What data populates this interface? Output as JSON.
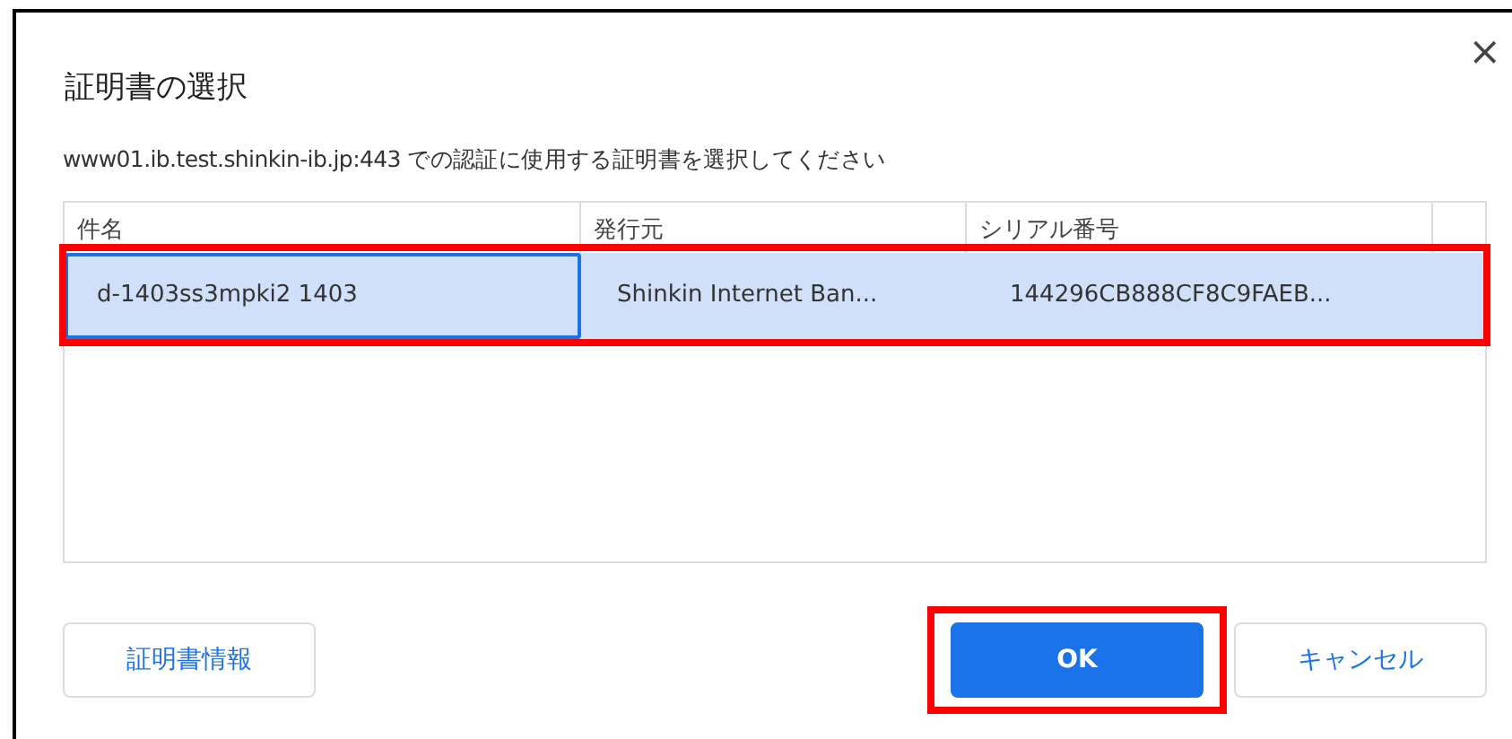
{
  "dialog": {
    "title": "証明書の選択",
    "message": "www01.ib.test.shinkin-ib.jp:443 での認証に使用する証明書を選択してください",
    "close": "×"
  },
  "table": {
    "columns": [
      "件名",
      "発行元",
      "シリアル番号"
    ],
    "rows": [
      {
        "cells": [
          "d-1403ss3mpki2 1403",
          "Shinkin Internet Ban...",
          "144296CB888CF8C9FAEB..."
        ],
        "selected": true,
        "highlighted": true
      }
    ]
  },
  "buttons": [
    {
      "label": "証明書情報",
      "kind": "secondary",
      "highlighted": false
    },
    {
      "label": "OK",
      "kind": "primary",
      "highlighted": true
    },
    {
      "label": "キャンセル",
      "kind": "secondary",
      "highlighted": false
    }
  ]
}
